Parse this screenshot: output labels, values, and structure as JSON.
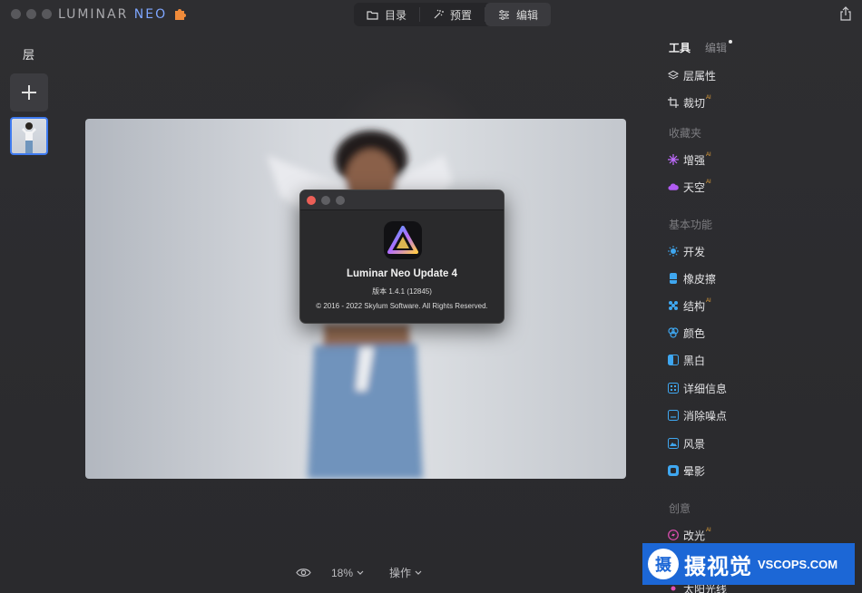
{
  "app": {
    "logo_main": "LUMINAR",
    "logo_accent": "NEO"
  },
  "nav": {
    "catalog": "目录",
    "presets": "预置",
    "edit": "编辑"
  },
  "left_panel": {
    "title": "层"
  },
  "dialog": {
    "title": "Luminar Neo Update 4",
    "version": "版本 1.4.1 (12845)",
    "copyright": "© 2016 - 2022 Skylum Software. All Rights Reserved."
  },
  "bottom": {
    "zoom": "18%",
    "actions": "操作"
  },
  "right_panel": {
    "tab_tools": "工具",
    "tab_edits": "编辑",
    "layer_props": "层属性",
    "crop": "裁切",
    "section_favorites": "收藏夹",
    "enhance": "增强",
    "sky": "天空",
    "section_essentials": "基本功能",
    "develop": "开发",
    "erase": "橡皮擦",
    "structure": "结构",
    "color": "颜色",
    "bw": "黑白",
    "details": "详细信息",
    "denoise": "消除噪点",
    "landscape": "风景",
    "vignette": "晕影",
    "section_creative": "创意",
    "relight": "改光",
    "sunrays": "太阳光线",
    "ai_badge": "AI"
  },
  "watermark": {
    "badge": "摄",
    "cn": "摄视觉",
    "en": "VSCOPS.COM"
  },
  "colors": {
    "accent_blue": "#3f7bf0",
    "ai_badge": "#e7a43b",
    "watermark_bg": "#1c67d6"
  }
}
